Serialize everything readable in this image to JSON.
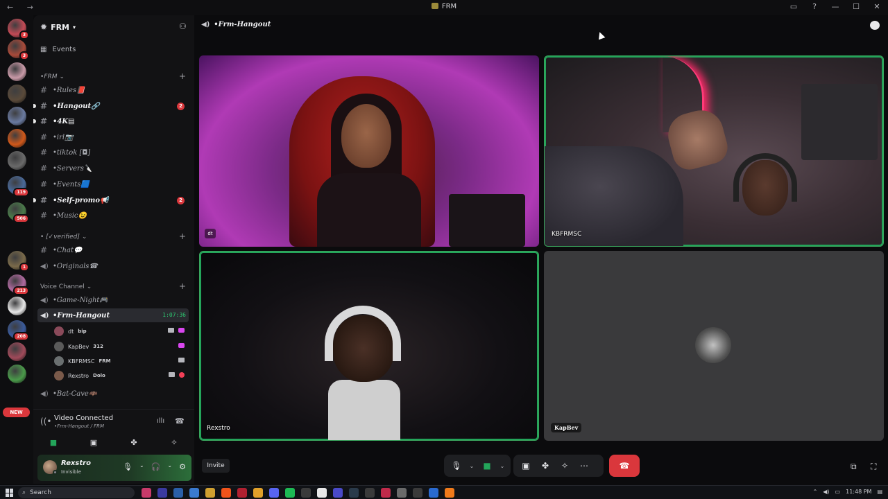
{
  "window": {
    "title": "FRM",
    "nav": "←  →"
  },
  "guild": {
    "name": "FRM",
    "events_label": "Events"
  },
  "categories": [
    {
      "label": "•FRM",
      "channels": [
        {
          "name": "•Rules📕",
          "unread": false
        },
        {
          "name": "•Hangout🔗",
          "unread": true,
          "badge": "2"
        },
        {
          "name": "•4K▤",
          "unread": true
        },
        {
          "name": "•irl📷",
          "unread": false
        },
        {
          "name": "•tiktok [◘]",
          "unread": false
        },
        {
          "name": "•Servers🔪",
          "unread": false
        },
        {
          "name": "•Events🟦",
          "unread": false
        },
        {
          "name": "•Self-promo📢",
          "unread": true,
          "badge": "2"
        },
        {
          "name": "•Music😉",
          "unread": false
        }
      ]
    },
    {
      "label": "• [✓verified]",
      "channels": [
        {
          "name": "•Chat💬",
          "unread": false
        },
        {
          "name": "•Originals☎",
          "unread": false
        }
      ]
    },
    {
      "label": "Voice Channel",
      "channels": [
        {
          "name": "•Game-Night🎮"
        },
        {
          "name": "•Frm-Hangout",
          "timer": "1:07:36"
        },
        {
          "name": "•Bat-Cave🦇"
        }
      ]
    }
  ],
  "voice_users": [
    {
      "name": "dt",
      "tag": "bip",
      "color": "#8a4a5a"
    },
    {
      "name": "KapBev",
      "tag": "312",
      "color": "#5a5a5a"
    },
    {
      "name": "KBFRMSC",
      "tag": "FRM",
      "color": "#6a6f70"
    },
    {
      "name": "Rexstro",
      "tag": "Dolo",
      "color": "#7a5a4a"
    }
  ],
  "voice_connected": {
    "title": "Video Connected",
    "subtitle": "•Frm-Hangout / FRM"
  },
  "user": {
    "name": "Rexstro",
    "status": "Invisible"
  },
  "main": {
    "channel_title": "•Frm-Hangout"
  },
  "tiles": [
    {
      "label": "dt"
    },
    {
      "label": "KBFRMSC"
    },
    {
      "label": "Rexstro"
    },
    {
      "label": "KapBev"
    }
  ],
  "toolbar": {
    "invite_label": "Invite"
  },
  "taskbar": {
    "search_placeholder": "Search",
    "time": "11:48 PM"
  },
  "rail": {
    "servers": [
      {
        "color": "#c24a55",
        "badge": "3"
      },
      {
        "color": "#a84a3a",
        "badge": "3"
      },
      {
        "color": "#c99aa8",
        "badge": ""
      },
      {
        "color": "#5a4a3a",
        "badge": ""
      },
      {
        "color": "#6a7aa0",
        "badge": ""
      },
      {
        "color": "#d0581a",
        "badge": ""
      },
      {
        "color": "#6a6a6a",
        "badge": ""
      },
      {
        "color": "#4a6a9a",
        "badge": "119"
      },
      {
        "color": "#4a7a4a",
        "badge": "506"
      },
      {
        "color": "#7a6a4a",
        "badge": "1"
      },
      {
        "color": "#b06aa0",
        "badge": "213"
      },
      {
        "color": "#e8e8e8",
        "badge": ""
      },
      {
        "color": "#3a5a9a",
        "badge": "208"
      },
      {
        "color": "#a04a5a",
        "badge": ""
      },
      {
        "color": "#4a9a4a",
        "badge": ""
      }
    ],
    "new_label": "NEW"
  }
}
